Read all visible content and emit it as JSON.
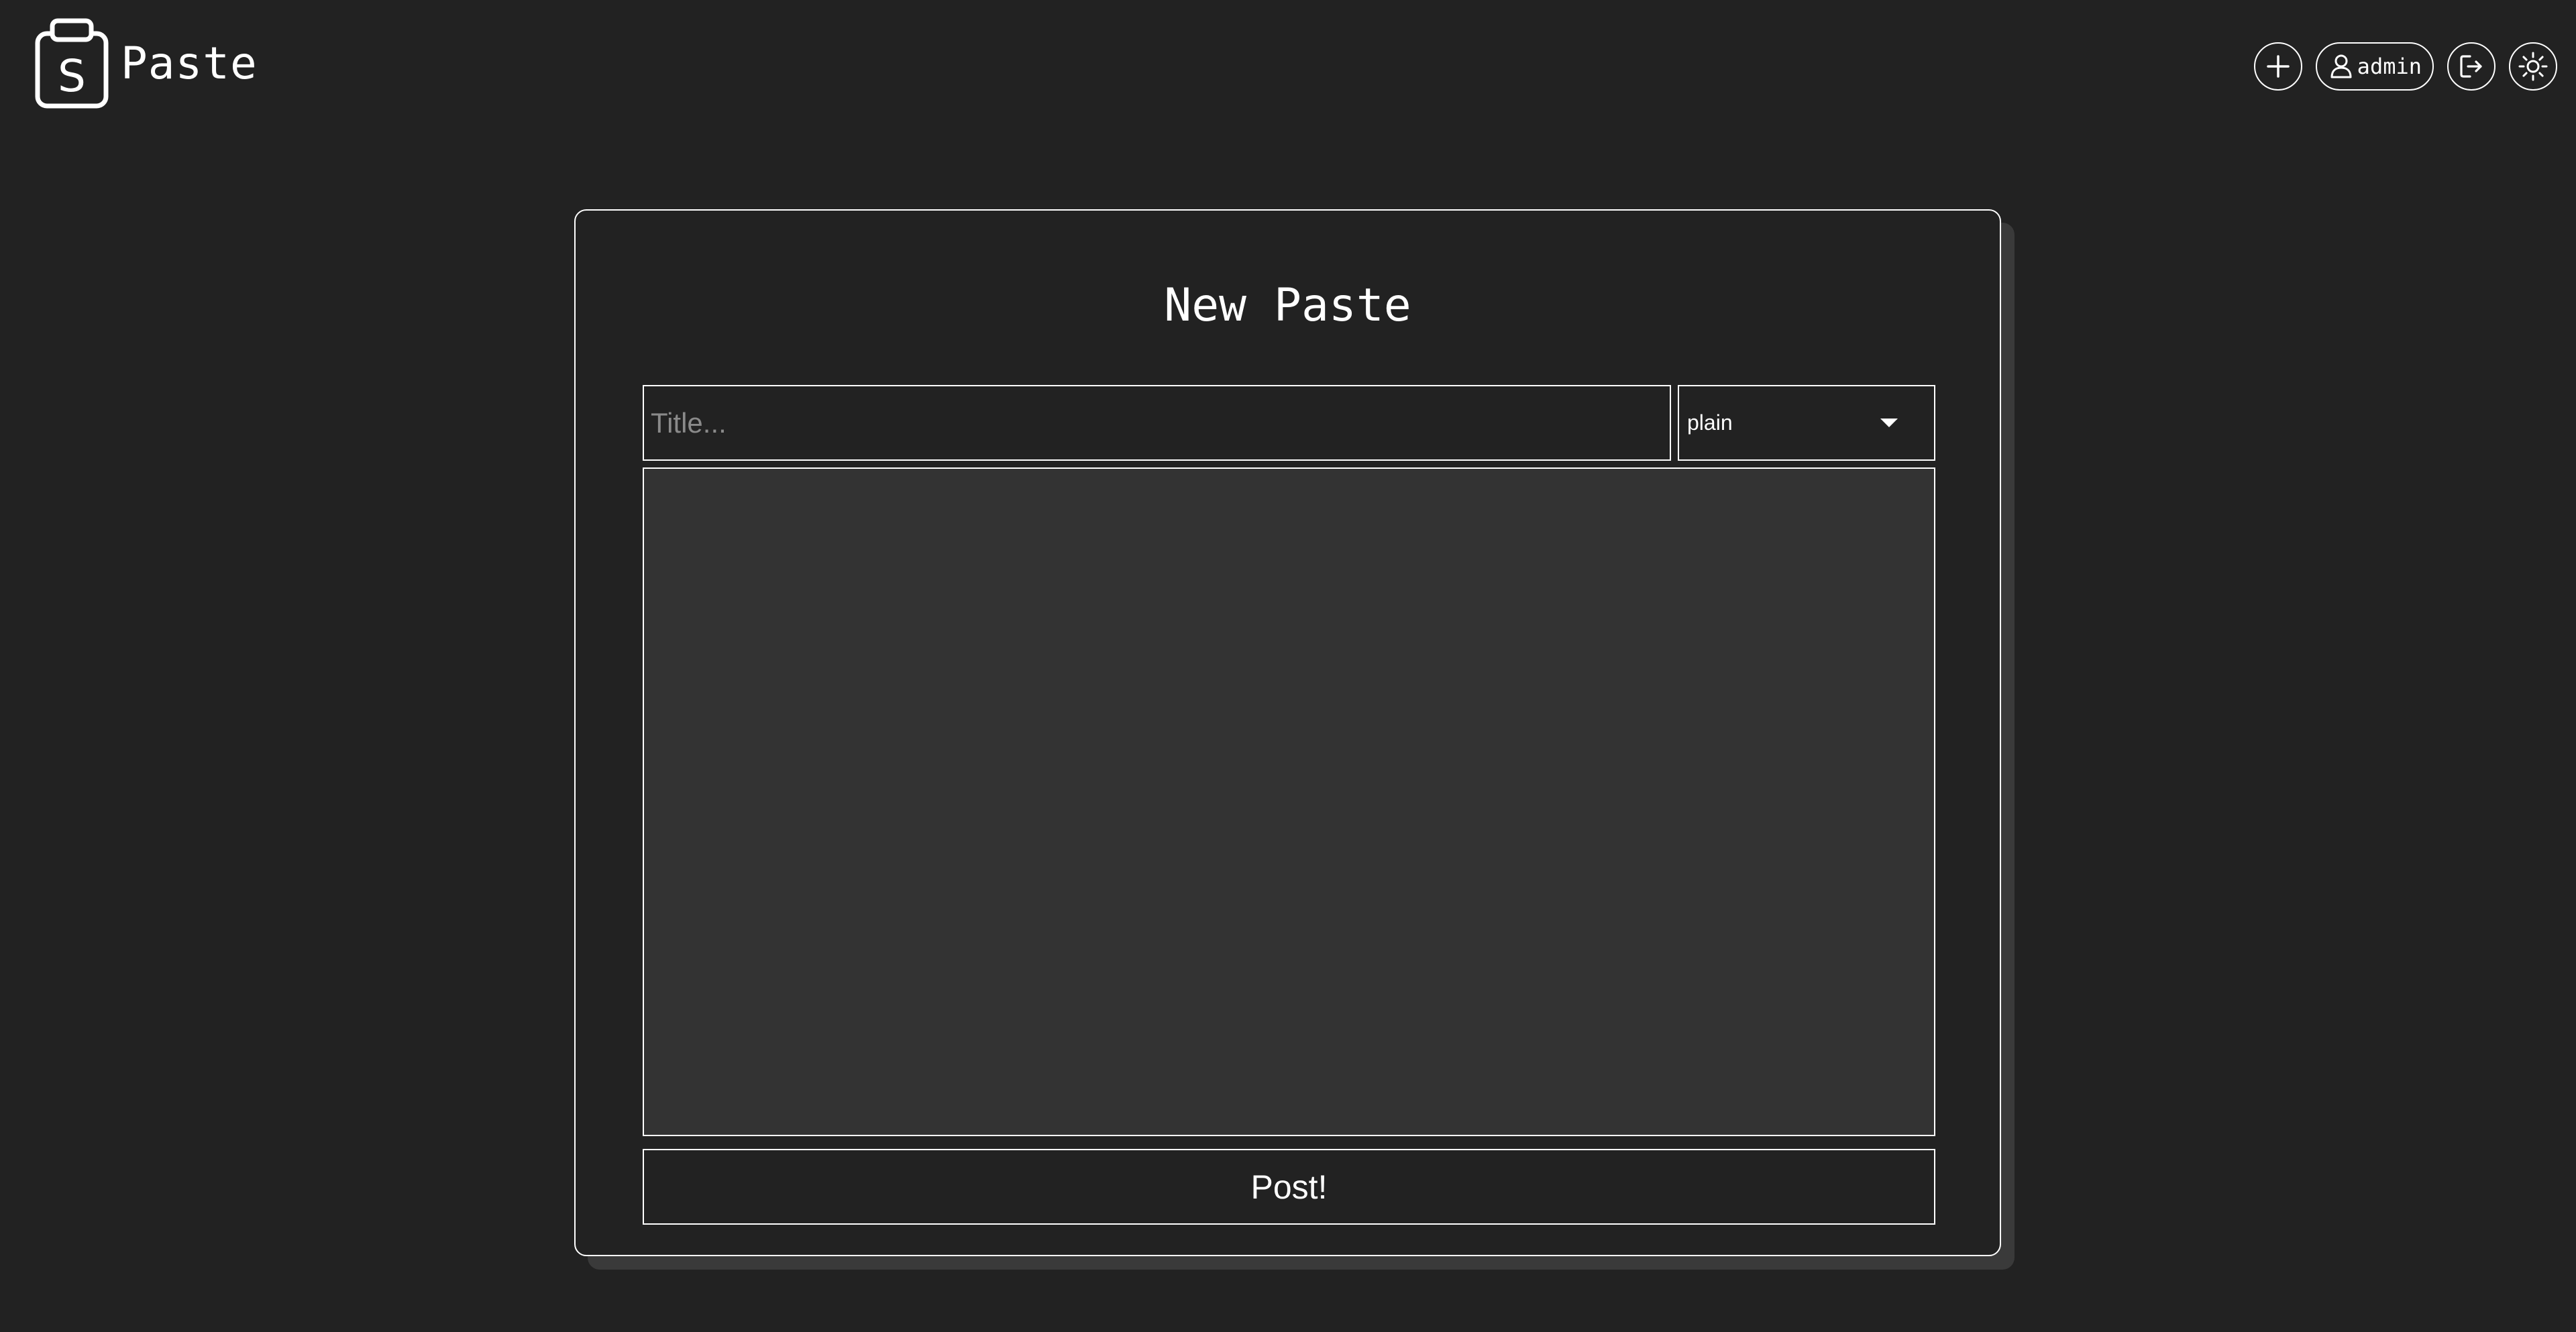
{
  "app": {
    "name": "Paste",
    "logo_letter": "S"
  },
  "nav": {
    "new_icon": "plus-icon",
    "user_icon": "user-icon",
    "username": "admin",
    "logout_icon": "logout-icon",
    "theme_icon": "sun-icon"
  },
  "form": {
    "heading": "New Paste",
    "title_placeholder": "Title...",
    "title_value": "",
    "language_selected": "plain",
    "content_value": "",
    "submit_label": "Post!"
  },
  "colors": {
    "background": "#222222",
    "textarea_background": "#333333",
    "foreground": "#ffffff",
    "placeholder": "#8a8a8a",
    "card_shadow": "#3a3a3a"
  }
}
